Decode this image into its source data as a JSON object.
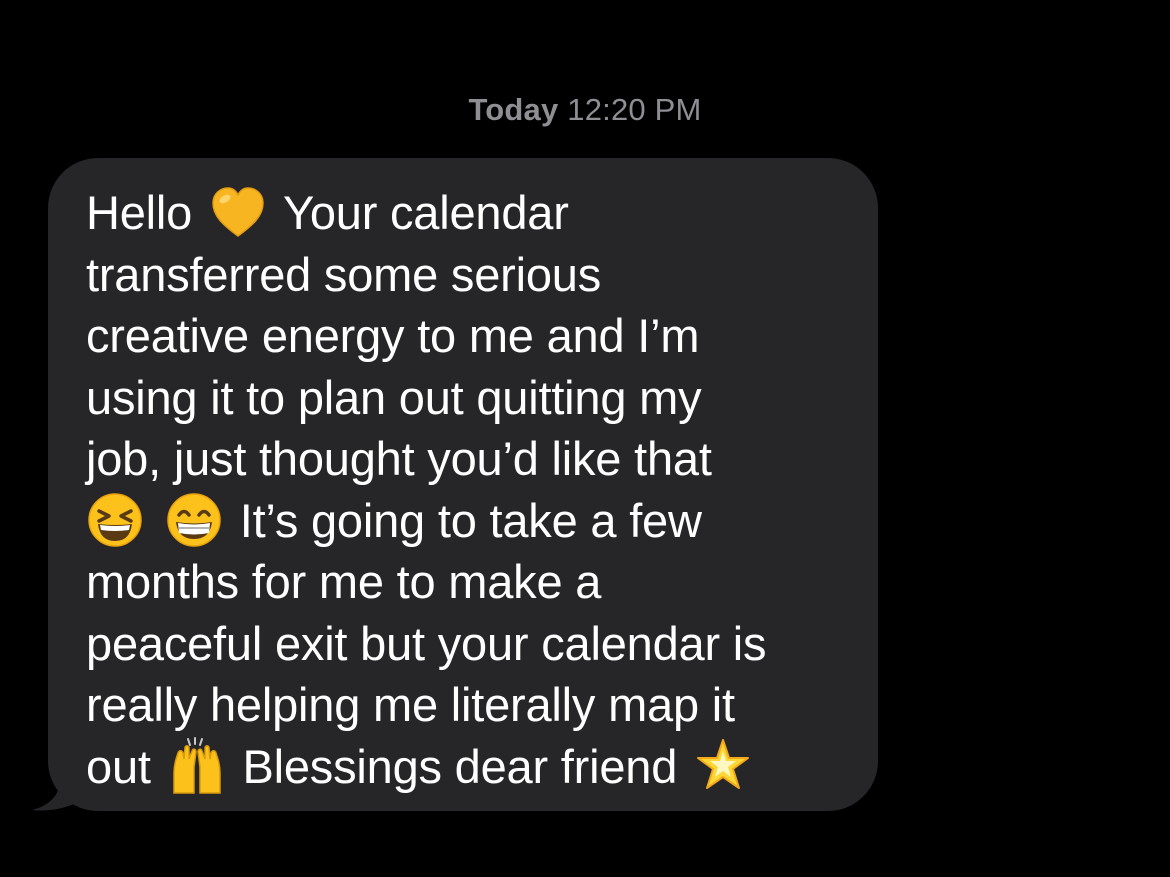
{
  "conversation": {
    "timestamp_day": "Today",
    "timestamp_time": "12:20 PM",
    "message": {
      "line1_a": "Hello",
      "line1_b": "Your calendar",
      "line2": "transferred some serious",
      "line3": "creative energy to me and I’m",
      "line4": "using it to plan out quitting my",
      "line5": "job, just thought you’d like that",
      "line6": "It’s going to take a few",
      "line7": "months for me to make a",
      "line8": "peaceful exit but your calendar is",
      "line9": "really helping me literally map it",
      "line10_a": "out",
      "line10_b": "Blessings dear friend"
    },
    "emojis": [
      "yellow-heart-icon",
      "grinning-squinting-face-icon",
      "beaming-face-icon",
      "raising-hands-icon",
      "glowing-star-icon"
    ]
  },
  "colors": {
    "background": "#000000",
    "bubble": "#262628",
    "text": "#ffffff",
    "timestamp": "#8e8e93"
  }
}
